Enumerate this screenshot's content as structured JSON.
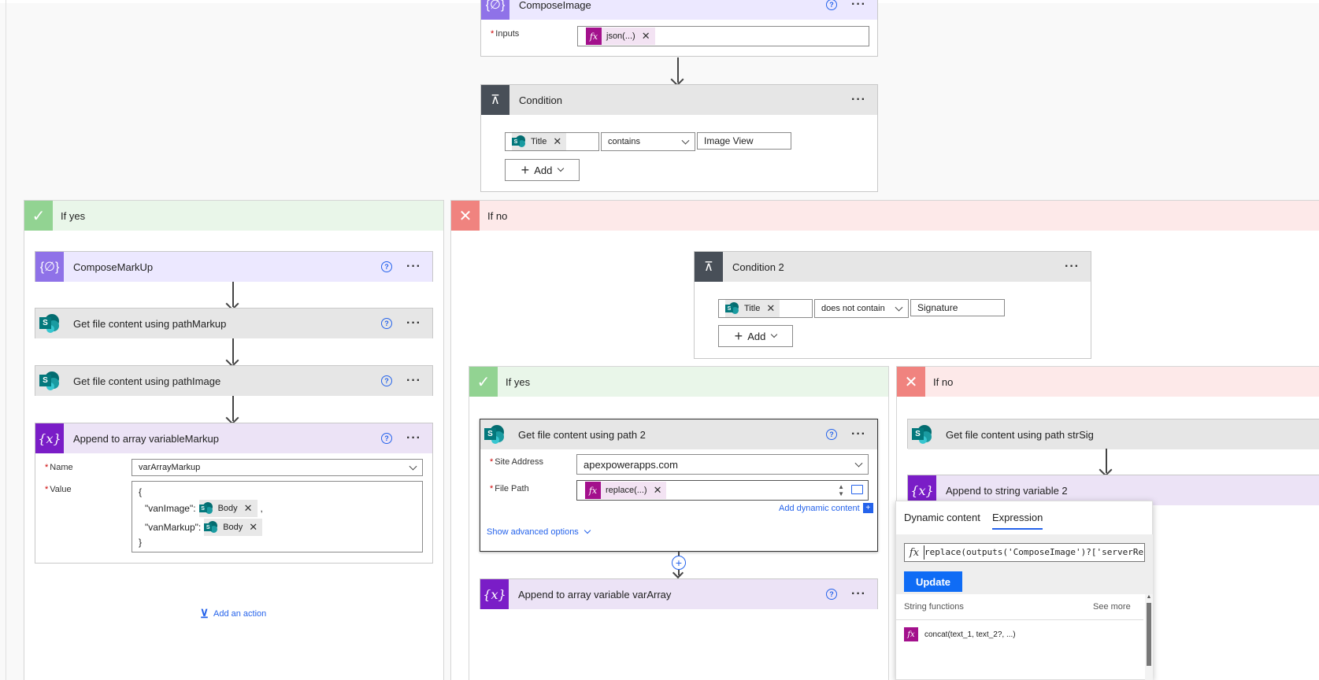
{
  "cards": {
    "compose_image": {
      "title": "ComposeImage",
      "inputs_label": "Inputs",
      "inputs_token": "json(...)"
    },
    "condition": {
      "title": "Condition",
      "left_token": "Title",
      "operator": "contains",
      "value": "Image View",
      "add_label": "Add"
    },
    "compose_markup": {
      "title": "ComposeMarkUp"
    },
    "get_markup": {
      "title": "Get file content using pathMarkup"
    },
    "get_image": {
      "title": "Get file content using pathImage"
    },
    "append_markup": {
      "title": "Append to array variableMarkup",
      "name_label": "Name",
      "name_value": "varArrayMarkup",
      "value_label": "Value",
      "line1": "{",
      "line2_key": "\"vanImage\":",
      "line2_token": "Body",
      "line2_comma": ",",
      "line3_key": "\"vanMarkup\":",
      "line3_token": "Body",
      "line4": "}"
    },
    "condition2": {
      "title": "Condition 2",
      "left_token": "Title",
      "operator": "does not contain",
      "value": "Signature",
      "add_label": "Add"
    },
    "get_path2": {
      "title": "Get file content using path 2",
      "site_label": "Site Address",
      "site_value": "apexpowerapps.com",
      "path_label": "File Path",
      "path_token": "replace(...)",
      "add_dynamic": "Add dynamic content",
      "advanced": "Show advanced options"
    },
    "append_varArray": {
      "title": "Append to array variable varArray"
    },
    "get_strSig": {
      "title": "Get file content using path strSig"
    },
    "append_string2": {
      "title": "Append to string variable 2"
    }
  },
  "branches": {
    "yes1": "If yes",
    "no1": "If no",
    "yes2": "If yes",
    "no2": "If no"
  },
  "add_action": "Add an action",
  "popup": {
    "tab_dynamic": "Dynamic content",
    "tab_expression": "Expression",
    "expression_text": " replace(outputs('ComposeImage')?['serverRe",
    "update_label": "Update",
    "section_title": "String functions",
    "see_more": "See more",
    "fn_item": "concat(text_1, text_2?, ...)"
  },
  "colors": {
    "compose": "#8f72e8",
    "condition": "#484f58",
    "variable": "#7a1dc7",
    "sharepoint": "#036c70",
    "expression": "#a3108c",
    "yes": "#92d392",
    "no": "#f0837f",
    "link": "#2563eb"
  }
}
